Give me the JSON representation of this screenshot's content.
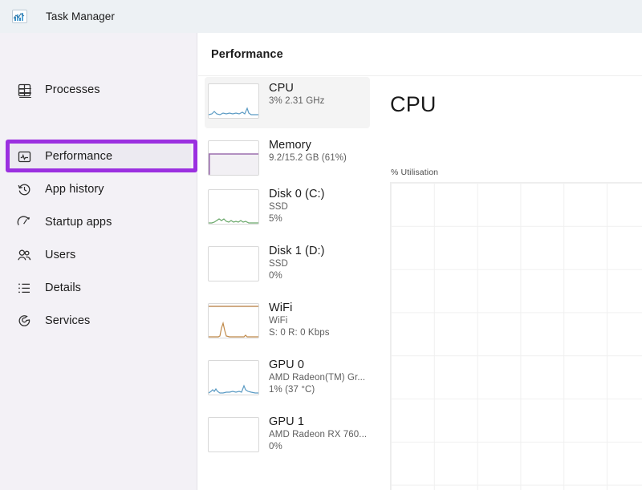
{
  "window": {
    "title": "Task Manager",
    "app_icon": "task-manager-chart-icon"
  },
  "sidebar": {
    "menu_icon": "hamburger-menu-icon",
    "items": [
      {
        "label": "Processes",
        "icon": "processes-grid-icon",
        "selected": false
      },
      {
        "label": "Performance",
        "icon": "performance-pulse-icon",
        "selected": true
      },
      {
        "label": "App history",
        "icon": "clock-history-icon",
        "selected": false
      },
      {
        "label": "Startup apps",
        "icon": "gauge-speed-icon",
        "selected": false
      },
      {
        "label": "Users",
        "icon": "users-people-icon",
        "selected": false
      },
      {
        "label": "Details",
        "icon": "list-details-icon",
        "selected": false
      },
      {
        "label": "Services",
        "icon": "services-gear-icon",
        "selected": false
      }
    ],
    "highlight_color": "#9b30e0"
  },
  "content": {
    "header": "Performance",
    "resources": [
      {
        "title": "CPU",
        "line1": "3%  2.31 GHz",
        "line2": "",
        "selected": true,
        "graph_color": "#4a90b8",
        "thumb": "sparkline-low-with-spike"
      },
      {
        "title": "Memory",
        "line1": "9.2/15.2 GB (61%)",
        "line2": "",
        "selected": false,
        "graph_color": "#9b59b6",
        "thumb": "filled-area-61-percent"
      },
      {
        "title": "Disk 0 (C:)",
        "line1": "SSD",
        "line2": "5%",
        "selected": false,
        "graph_color": "#4f9a4f",
        "thumb": "sparkline-low-green"
      },
      {
        "title": "Disk 1 (D:)",
        "line1": "SSD",
        "line2": "0%",
        "selected": false,
        "graph_color": "#4f9a4f",
        "thumb": "empty"
      },
      {
        "title": "WiFi",
        "line1": "WiFi",
        "line2": "S: 0 R: 0 Kbps",
        "selected": false,
        "graph_color": "#b5793a",
        "thumb": "sparkline-spikes-orange"
      },
      {
        "title": "GPU 0",
        "line1": "AMD Radeon(TM) Gr...",
        "line2": "1%  (37 °C)",
        "selected": false,
        "graph_color": "#4a90b8",
        "thumb": "sparkline-low-blue"
      },
      {
        "title": "GPU 1",
        "line1": "AMD Radeon RX 760...",
        "line2": "0%",
        "selected": false,
        "graph_color": "#4a90b8",
        "thumb": "empty"
      }
    ],
    "graph": {
      "title": "CPU",
      "axis_label": "% Utilisation"
    }
  },
  "chart_data": {
    "type": "line",
    "title": "CPU",
    "ylabel": "% Utilisation",
    "xlabel": "",
    "ylim": [
      0,
      100
    ],
    "grid": true,
    "legend": false,
    "series": [
      {
        "name": "% Utilisation",
        "values": []
      }
    ],
    "note": "Live CPU utilisation plot area is empty/blank in this screenshot; only the grid is visible."
  }
}
